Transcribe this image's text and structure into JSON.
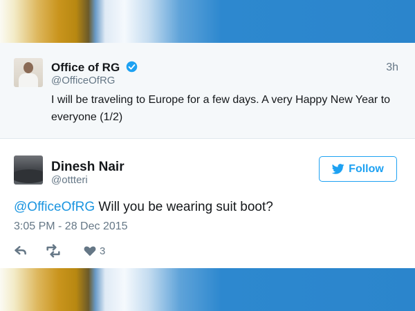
{
  "tweet_top": {
    "display_name": "Office of RG",
    "handle": "@OfficeOfRG",
    "time_ago": "3h",
    "text": "I will be traveling to Europe for a few days. A very Happy New Year to everyone (1/2)"
  },
  "tweet_main": {
    "display_name": "Dinesh Nair",
    "handle": "@ottteri",
    "follow_label": "Follow",
    "mention": "@OfficeOfRG",
    "body": " Will you be wearing suit boot?",
    "timestamp": "3:05 PM - 28 Dec 2015",
    "like_count": "3"
  },
  "colors": {
    "accent": "#1da1f2",
    "mention": "#1b95e0",
    "verified": "#1da1f2",
    "muted": "#657786"
  },
  "icons": [
    "verified-badge-icon",
    "twitter-bird-icon",
    "reply-icon",
    "retweet-icon",
    "heart-icon"
  ]
}
